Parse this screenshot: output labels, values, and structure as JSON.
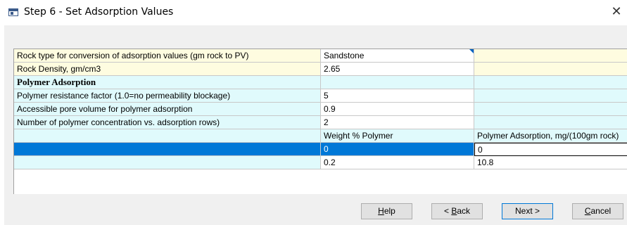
{
  "window": {
    "title": "Step 6 - Set Adsorption Values",
    "close_glyph": "✕"
  },
  "grid": {
    "rows": [
      {
        "label": "Rock type for conversion of adsorption values (gm rock to PV)",
        "value": "Sandstone",
        "extra": ""
      },
      {
        "label": "Rock Density, gm/cm3",
        "value": "2.65",
        "extra": ""
      },
      {
        "label": "Polymer Adsorption",
        "value": "",
        "extra": ""
      },
      {
        "label": "Polymer resistance factor (1.0=no permeability blockage)",
        "value": "5",
        "extra": ""
      },
      {
        "label": "Accessible pore volume for polymer adsorption",
        "value": "0.9",
        "extra": ""
      },
      {
        "label": "Number of polymer concentration vs. adsorption rows)",
        "value": "2",
        "extra": ""
      },
      {
        "label": "",
        "value": "Weight % Polymer",
        "extra": "Polymer Adsorption, mg/(100gm rock)"
      },
      {
        "label": "",
        "value": "0",
        "extra": "0"
      },
      {
        "label": "",
        "value": "0.2",
        "extra": "10.8"
      }
    ]
  },
  "buttons": {
    "help": {
      "mnemonic": "H",
      "rest": "elp"
    },
    "back": {
      "prefix": "< ",
      "mnemonic": "B",
      "rest": "ack"
    },
    "next": "Next >",
    "cancel": {
      "mnemonic": "C",
      "rest": "ancel"
    }
  },
  "colors": {
    "selection": "#0078d7",
    "yellow_row": "#fefce0",
    "cyan_row": "#e0fafc"
  }
}
